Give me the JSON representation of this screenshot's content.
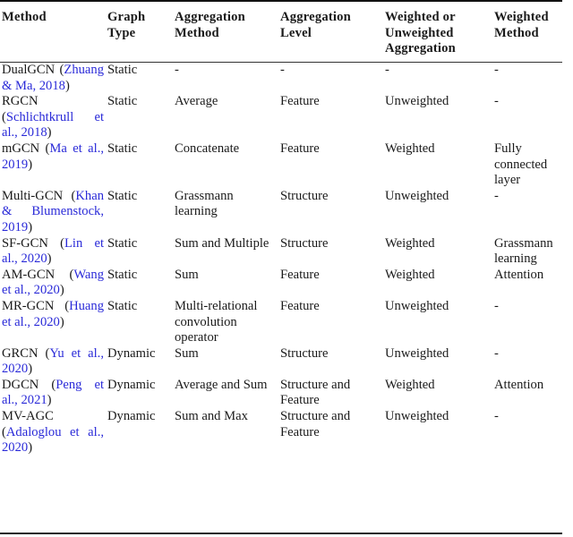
{
  "table": {
    "headers": [
      "Method",
      "Graph Type",
      "Aggregation Method",
      "Aggregation Level",
      "Weighted or Unweighted Aggregation",
      "Weighted Method"
    ],
    "rows": [
      {
        "method": "DualGCN",
        "citation": "Zhuang & Ma, 2018",
        "graph_type": "Static",
        "aggregation_method": "-",
        "aggregation_level": "-",
        "weighted": "-",
        "weighted_method": "-"
      },
      {
        "method": "RGCN",
        "citation": "Schlichtkrull et al., 2018",
        "graph_type": "Static",
        "aggregation_method": "Average",
        "aggregation_level": "Feature",
        "weighted": "Unweighted",
        "weighted_method": "-"
      },
      {
        "method": "mGCN",
        "citation": "Ma et al., 2019",
        "graph_type": "Static",
        "aggregation_method": "Concatenate",
        "aggregation_level": "Feature",
        "weighted": "Weighted",
        "weighted_method": "Fully connected layer"
      },
      {
        "method": "Multi-GCN",
        "citation": "Khan & Blumenstock, 2019",
        "graph_type": "Static",
        "aggregation_method": "Grassmann learning",
        "aggregation_level": "Structure",
        "weighted": "Unweighted",
        "weighted_method": "-"
      },
      {
        "method": "SF-GCN",
        "citation": "Lin et al., 2020",
        "graph_type": "Static",
        "aggregation_method": "Sum and Multiple",
        "aggregation_level": "Structure",
        "weighted": "Weighted",
        "weighted_method": "Grassmann learning"
      },
      {
        "method": "AM-GCN",
        "citation": "Wang et al., 2020",
        "graph_type": "Static",
        "aggregation_method": "Sum",
        "aggregation_level": "Feature",
        "weighted": "Weighted",
        "weighted_method": "Attention"
      },
      {
        "method": "MR-GCN",
        "citation": "Huang et al., 2020",
        "graph_type": "Static",
        "aggregation_method": "Multi-relational convolution operator",
        "aggregation_level": "Feature",
        "weighted": "Unweighted",
        "weighted_method": "-"
      },
      {
        "method": "GRCN",
        "citation": "Yu et al., 2020",
        "graph_type": "Dynamic",
        "aggregation_method": "Sum",
        "aggregation_level": "Structure",
        "weighted": "Unweighted",
        "weighted_method": "-"
      },
      {
        "method": "DGCN",
        "citation": "Peng et al., 2021",
        "graph_type": "Dynamic",
        "aggregation_method": "Average and Sum",
        "aggregation_level": "Structure and Feature",
        "weighted": "Weighted",
        "weighted_method": "Attention"
      },
      {
        "method": "MV-AGC",
        "citation": "Adaloglou et al., 2020",
        "graph_type": "Dynamic",
        "aggregation_method": "Sum and Max",
        "aggregation_level": "Structure and Feature",
        "weighted": "Unweighted",
        "weighted_method": "-"
      }
    ]
  },
  "colors": {
    "citation_link": "#2a2ad8",
    "text": "#1a1a1a",
    "rule": "#111111"
  }
}
